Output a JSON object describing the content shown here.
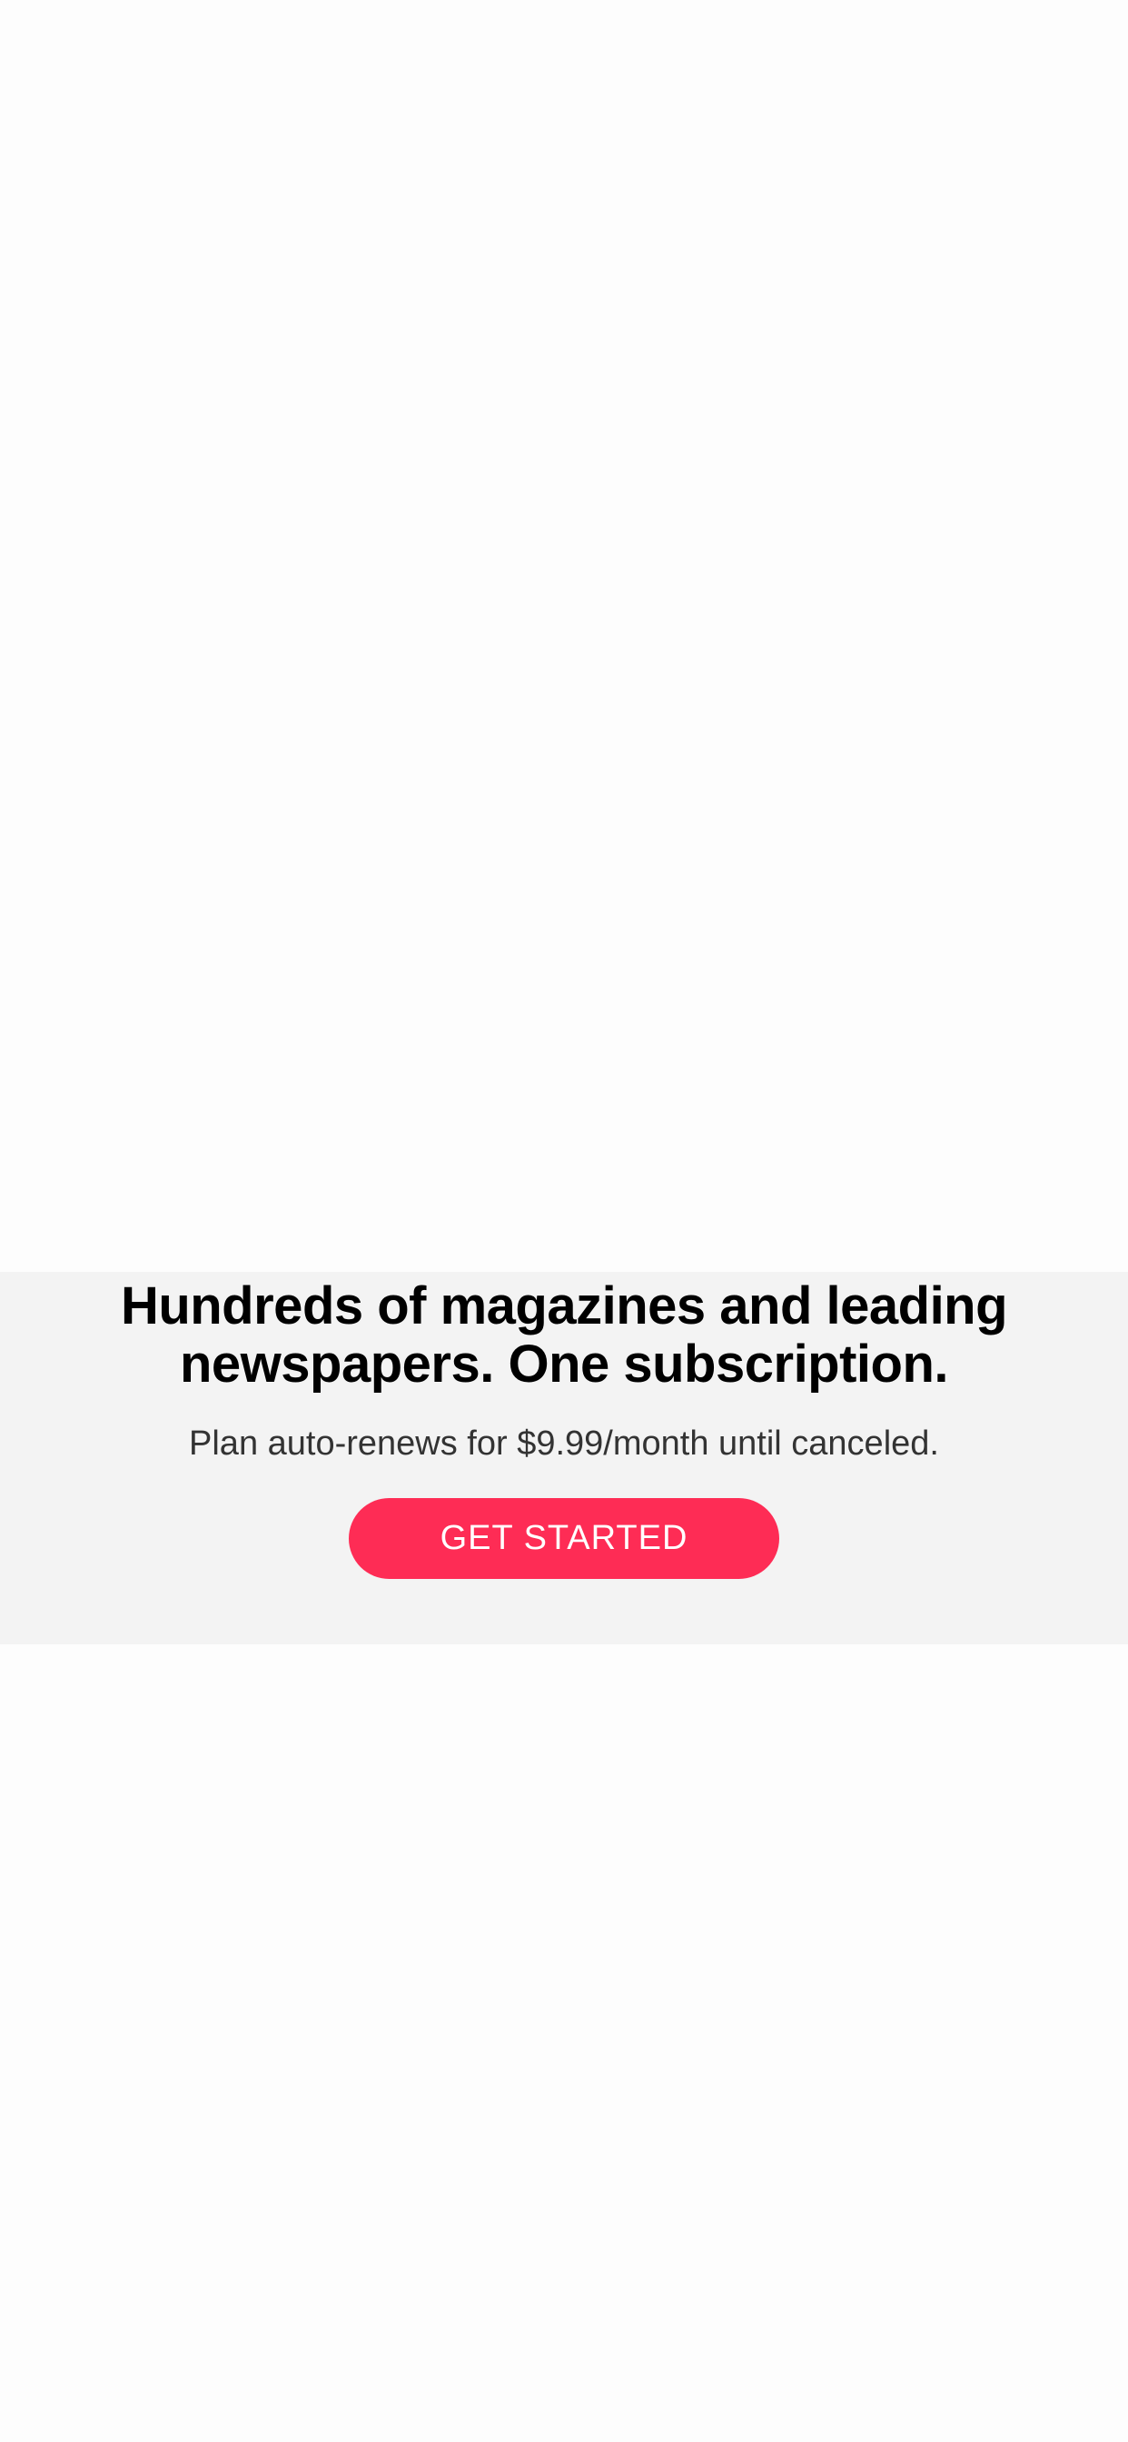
{
  "promo": {
    "headline": "Hundreds of magazines and leading newspapers. One subscription.",
    "plan_text": "Plan auto-renews for $9.99/month until canceled.",
    "cta_label": "GET STARTED"
  },
  "colors": {
    "accent": "#fe2c55",
    "panel_background": "#f3f3f3",
    "page_background": "#fdfdfd",
    "headline_text": "#000000",
    "body_text": "#333333"
  }
}
